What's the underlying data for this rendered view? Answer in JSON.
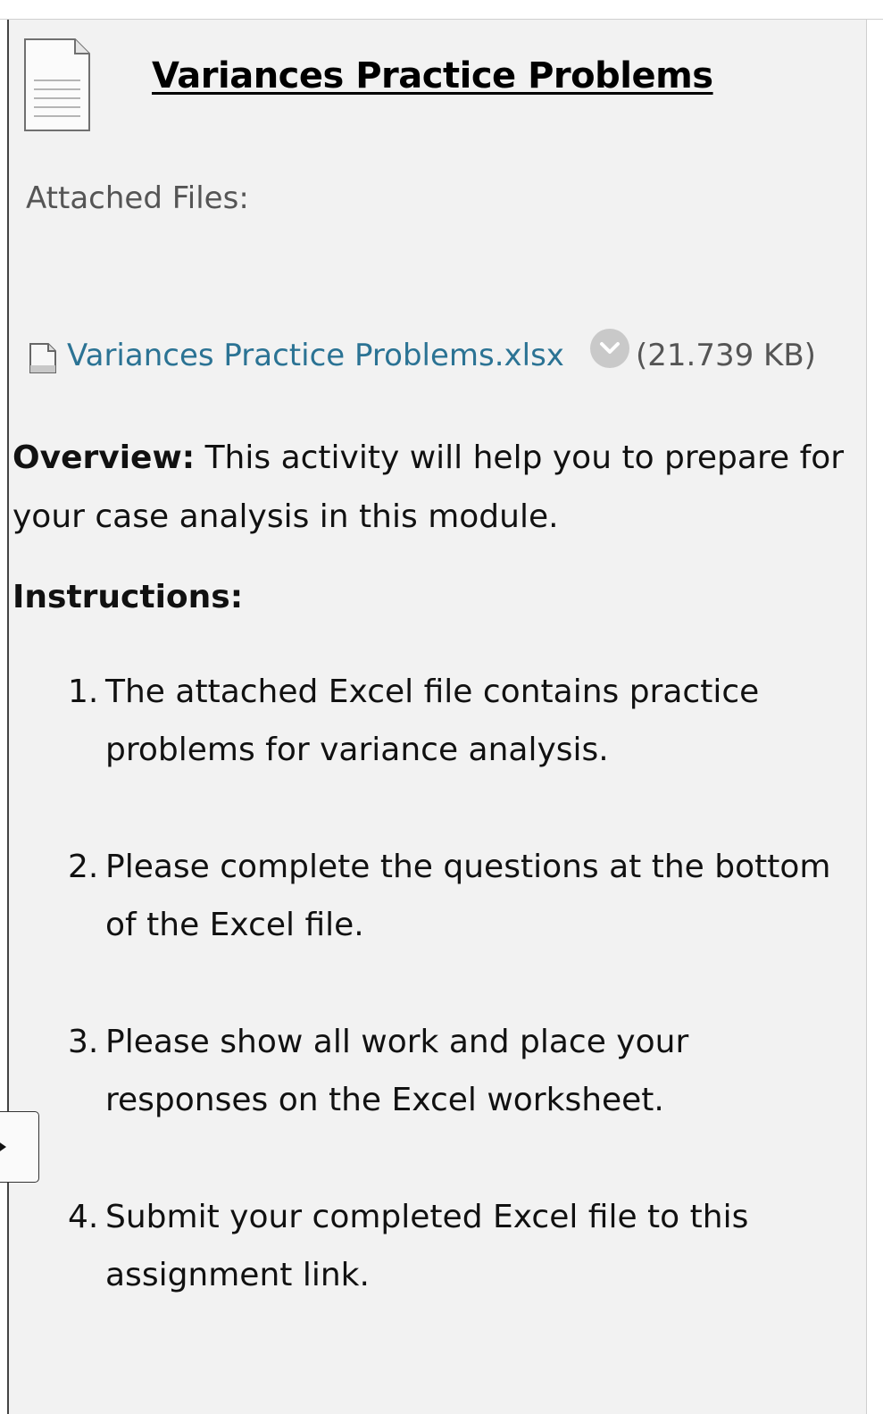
{
  "content": {
    "title": "Variances Practice Problems",
    "attached_files_label": "Attached Files:",
    "attachment": {
      "filename": "Variances Practice Problems.xlsx",
      "size": "(21.739 KB)"
    },
    "overview_label": "Overview:",
    "overview_text": " This activity will help you to prepare for your case analysis in this module.",
    "instructions_heading": "Instructions:",
    "steps": [
      {
        "num": "1.",
        "text": "The attached Excel file contains practice problems for variance analysis."
      },
      {
        "num": "2.",
        "text": "Please complete the questions at the bottom of the Excel file."
      },
      {
        "num": "3.",
        "text": "Please show all work and place your responses on the Excel worksheet."
      },
      {
        "num": "4.",
        "text": "Submit your completed Excel file to this assignment link."
      }
    ]
  },
  "icons": {
    "item_icon": "document-icon",
    "file_icon": "file-icon",
    "menu_icon": "chevron-down-icon",
    "side_tab_icon": "arrow-right-icon"
  },
  "colors": {
    "link": "#2b7394",
    "panel_bg": "#f2f2f2"
  }
}
